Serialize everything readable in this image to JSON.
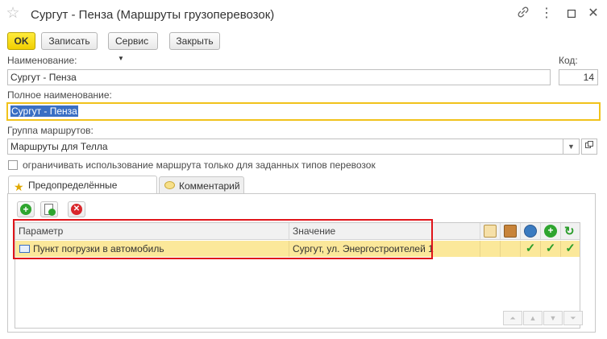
{
  "window": {
    "title": "Сургут - Пенза (Маршруты грузоперевозок)"
  },
  "toolbar": {
    "ok_label": "OK",
    "write_label": "Записать",
    "service_label": "Сервис",
    "close_label": "Закрыть"
  },
  "form": {
    "name_label": "Наименование:",
    "name_value": "Сургут - Пенза",
    "code_label": "Код:",
    "code_value": "14",
    "full_name_label": "Полное наименование:",
    "full_name_value": "Сургут - Пенза",
    "group_label": "Группа маршрутов:",
    "group_value": "Маршруты для Телла",
    "restrict_checkbox_label": "ограничивать использование маршрута только для заданных типов перевозок"
  },
  "tabs": [
    {
      "label": "Предопределённые значения",
      "active": true
    },
    {
      "label": "Комментарий",
      "active": false
    }
  ],
  "table": {
    "columns": [
      "Параметр",
      "Значение"
    ],
    "rows": [
      {
        "parameter": "Пункт погрузки в автомобиль",
        "value": "Сургут, ул. Энергостроителей 1",
        "checks": [
          "✓",
          "✓",
          "✓"
        ]
      }
    ]
  },
  "colors": {
    "accent_yellow": "#f1cf00",
    "selection_row": "#fbe89a",
    "highlight_box": "#e0141a",
    "check_green": "#2a9d2a"
  }
}
